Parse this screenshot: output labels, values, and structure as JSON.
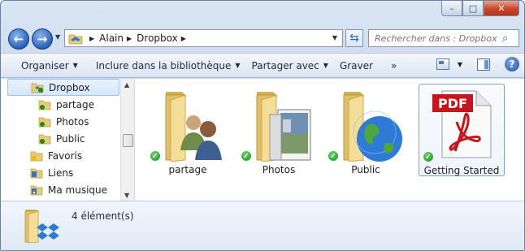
{
  "window": {
    "caption": {
      "minimize": "–",
      "maximize": "□",
      "close": "✕"
    }
  },
  "address": {
    "segments": [
      "Alain",
      "Dropbox"
    ]
  },
  "search": {
    "placeholder": "Rechercher dans : Dropbox"
  },
  "commands": [
    {
      "label": "Organiser",
      "dropdown": true
    },
    {
      "label": "Inclure dans la bibliothèque",
      "dropdown": true
    },
    {
      "label": "Partager avec",
      "dropdown": true
    },
    {
      "label": "Graver",
      "dropdown": false
    },
    {
      "label": "»",
      "dropdown": false
    }
  ],
  "navpane": {
    "items": [
      {
        "label": "Dropbox",
        "icon": "dropbox-folder-icon",
        "selected": true
      },
      {
        "label": "partage",
        "icon": "synced-folder-icon"
      },
      {
        "label": "Photos",
        "icon": "synced-folder-icon"
      },
      {
        "label": "Public",
        "icon": "synced-folder-icon"
      },
      {
        "label": "Favoris",
        "icon": "favorites-star-icon"
      },
      {
        "label": "Liens",
        "icon": "links-folder-icon"
      },
      {
        "label": "Ma musique",
        "icon": "music-folder-icon"
      }
    ]
  },
  "files": [
    {
      "label": "partage",
      "icon": "shared-folder-icon",
      "synced": true
    },
    {
      "label": "Photos",
      "icon": "photos-folder-icon",
      "synced": true
    },
    {
      "label": "Public",
      "icon": "public-folder-icon",
      "synced": true
    },
    {
      "label": "Getting Started",
      "icon": "pdf-file-icon",
      "synced": true,
      "selected": true
    }
  ],
  "status": {
    "count_text": "4 élément(s)"
  },
  "colors": {
    "accent": "#2a62b8",
    "sync_check": "#1b8c1b",
    "pdf_red": "#c4161c"
  }
}
